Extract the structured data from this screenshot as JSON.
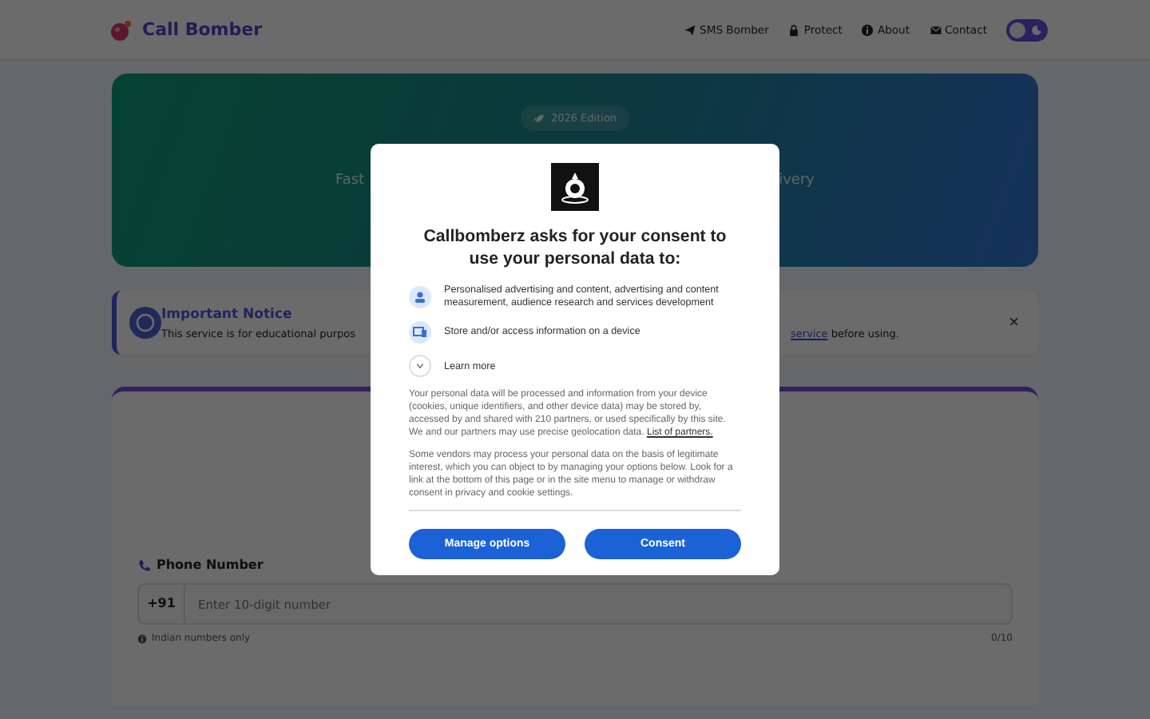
{
  "header": {
    "brand": "Call Bomber",
    "nav": [
      {
        "label": "SMS Bomber"
      },
      {
        "label": "Protect"
      },
      {
        "label": "About"
      },
      {
        "label": "Contact"
      }
    ],
    "dark_mode": false
  },
  "hero": {
    "badge": "2026 Edition",
    "subtitle_start": "Fast",
    "subtitle_end": "ivery"
  },
  "notice": {
    "title": "Important Notice",
    "text_start": "This service is for educational purpos",
    "link": "service",
    "text_end": " before using.",
    "close": "×"
  },
  "form": {
    "label": "Phone Number",
    "prefix": "+91",
    "placeholder": "Enter 10-digit number",
    "hint": "Indian numbers only",
    "counter": "0/10"
  },
  "consent": {
    "title": "Callbomberz asks for your consent to use your personal data to:",
    "purposes": [
      {
        "text": "Personalised advertising and content, advertising and content measurement, audience research and services development"
      },
      {
        "text": "Store and/or access information on a device"
      }
    ],
    "learn_more": "Learn more",
    "paragraphs": [
      {
        "text": "Your personal data will be processed and information from your device (cookies, unique identifiers, and other device data) may be stored by, accessed by and shared with 210 partners, or used specifically by this site. We and our partners may use precise geolocation data. ",
        "link": "List of partners."
      },
      {
        "text": "Some vendors may process your personal data on the basis of legitimate interest, which you can object to by managing your options below. Look for a link at the bottom of this page or in the site menu to manage or withdraw consent in privacy and cookie settings."
      }
    ],
    "buttons": [
      "Manage options",
      "Consent"
    ]
  }
}
